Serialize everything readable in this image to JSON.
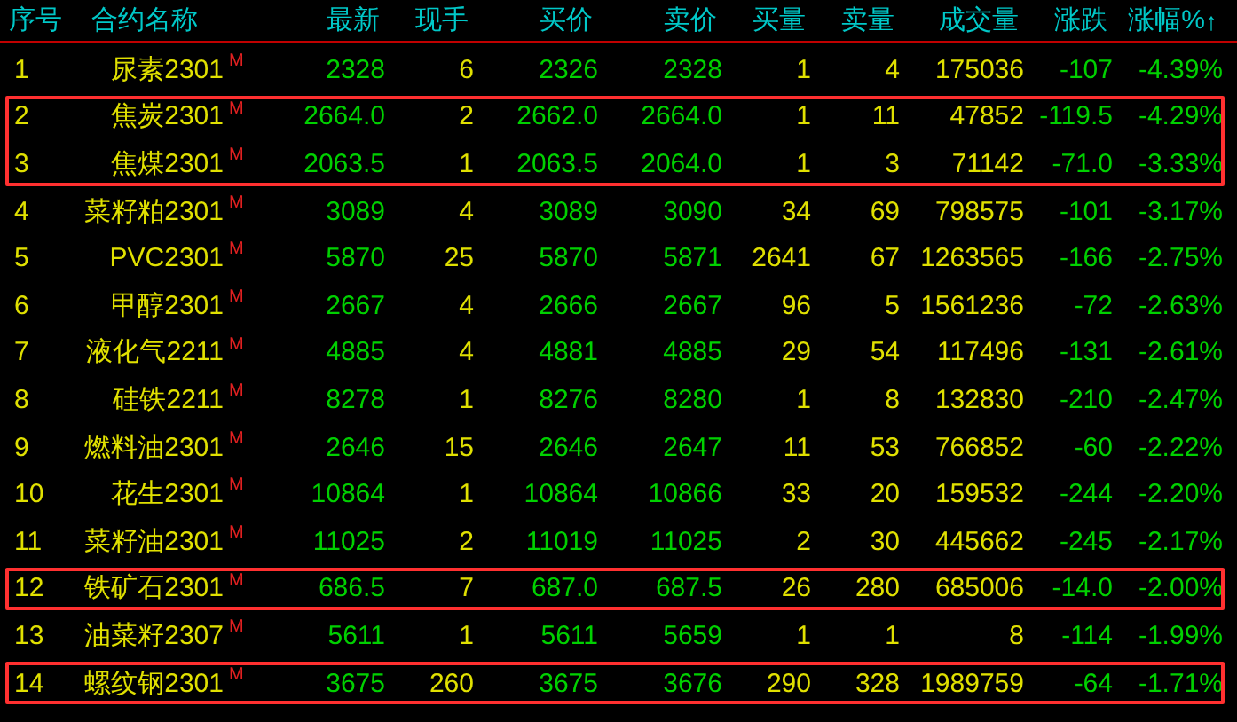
{
  "columns": [
    {
      "label": "序号"
    },
    {
      "label": "合约名称"
    },
    {
      "label": "最新"
    },
    {
      "label": "现手"
    },
    {
      "label": "买价"
    },
    {
      "label": "卖价"
    },
    {
      "label": "买量"
    },
    {
      "label": "卖量"
    },
    {
      "label": "成交量"
    },
    {
      "label": "涨跌"
    },
    {
      "label": "涨幅%",
      "sort_arrow": "↑"
    }
  ],
  "rows": [
    {
      "no": "1",
      "name": "尿素2301",
      "tag": "M",
      "last": "2328",
      "hand": "6",
      "bid": "2326",
      "ask": "2328",
      "bid_vol": "1",
      "ask_vol": "4",
      "volume": "175036",
      "change": "-107",
      "change_pct": "-4.39%",
      "highlighted": false
    },
    {
      "no": "2",
      "name": "焦炭2301",
      "tag": "M",
      "last": "2664.0",
      "hand": "2",
      "bid": "2662.0",
      "ask": "2664.0",
      "bid_vol": "1",
      "ask_vol": "11",
      "volume": "47852",
      "change": "-119.5",
      "change_pct": "-4.29%",
      "highlighted": true
    },
    {
      "no": "3",
      "name": "焦煤2301",
      "tag": "M",
      "last": "2063.5",
      "hand": "1",
      "bid": "2063.5",
      "ask": "2064.0",
      "bid_vol": "1",
      "ask_vol": "3",
      "volume": "71142",
      "change": "-71.0",
      "change_pct": "-3.33%",
      "highlighted": true
    },
    {
      "no": "4",
      "name": "菜籽粕2301",
      "tag": "M",
      "last": "3089",
      "hand": "4",
      "bid": "3089",
      "ask": "3090",
      "bid_vol": "34",
      "ask_vol": "69",
      "volume": "798575",
      "change": "-101",
      "change_pct": "-3.17%",
      "highlighted": false
    },
    {
      "no": "5",
      "name": "PVC2301",
      "tag": "M",
      "last": "5870",
      "hand": "25",
      "bid": "5870",
      "ask": "5871",
      "bid_vol": "2641",
      "ask_vol": "67",
      "volume": "1263565",
      "change": "-166",
      "change_pct": "-2.75%",
      "highlighted": false
    },
    {
      "no": "6",
      "name": "甲醇2301",
      "tag": "M",
      "last": "2667",
      "hand": "4",
      "bid": "2666",
      "ask": "2667",
      "bid_vol": "96",
      "ask_vol": "5",
      "volume": "1561236",
      "change": "-72",
      "change_pct": "-2.63%",
      "highlighted": false
    },
    {
      "no": "7",
      "name": "液化气2211",
      "tag": "M",
      "last": "4885",
      "hand": "4",
      "bid": "4881",
      "ask": "4885",
      "bid_vol": "29",
      "ask_vol": "54",
      "volume": "117496",
      "change": "-131",
      "change_pct": "-2.61%",
      "highlighted": false
    },
    {
      "no": "8",
      "name": "硅铁2211",
      "tag": "M",
      "last": "8278",
      "hand": "1",
      "bid": "8276",
      "ask": "8280",
      "bid_vol": "1",
      "ask_vol": "8",
      "volume": "132830",
      "change": "-210",
      "change_pct": "-2.47%",
      "highlighted": false
    },
    {
      "no": "9",
      "name": "燃料油2301",
      "tag": "M",
      "last": "2646",
      "hand": "15",
      "bid": "2646",
      "ask": "2647",
      "bid_vol": "11",
      "ask_vol": "53",
      "volume": "766852",
      "change": "-60",
      "change_pct": "-2.22%",
      "highlighted": false
    },
    {
      "no": "10",
      "name": "花生2301",
      "tag": "M",
      "last": "10864",
      "hand": "1",
      "bid": "10864",
      "ask": "10866",
      "bid_vol": "33",
      "ask_vol": "20",
      "volume": "159532",
      "change": "-244",
      "change_pct": "-2.20%",
      "highlighted": false
    },
    {
      "no": "11",
      "name": "菜籽油2301",
      "tag": "M",
      "last": "11025",
      "hand": "2",
      "bid": "11019",
      "ask": "11025",
      "bid_vol": "2",
      "ask_vol": "30",
      "volume": "445662",
      "change": "-245",
      "change_pct": "-2.17%",
      "highlighted": false
    },
    {
      "no": "12",
      "name": "铁矿石2301",
      "tag": "M",
      "last": "686.5",
      "hand": "7",
      "bid": "687.0",
      "ask": "687.5",
      "bid_vol": "26",
      "ask_vol": "280",
      "volume": "685006",
      "change": "-14.0",
      "change_pct": "-2.00%",
      "highlighted": true
    },
    {
      "no": "13",
      "name": "油菜籽2307",
      "tag": "M",
      "last": "5611",
      "hand": "1",
      "bid": "5611",
      "ask": "5659",
      "bid_vol": "1",
      "ask_vol": "1",
      "volume": "8",
      "change": "-114",
      "change_pct": "-1.99%",
      "highlighted": false
    },
    {
      "no": "14",
      "name": "螺纹钢2301",
      "tag": "M",
      "last": "3675",
      "hand": "260",
      "bid": "3675",
      "ask": "3676",
      "bid_vol": "290",
      "ask_vol": "328",
      "volume": "1989759",
      "change": "-64",
      "change_pct": "-1.71%",
      "highlighted": true
    }
  ]
}
